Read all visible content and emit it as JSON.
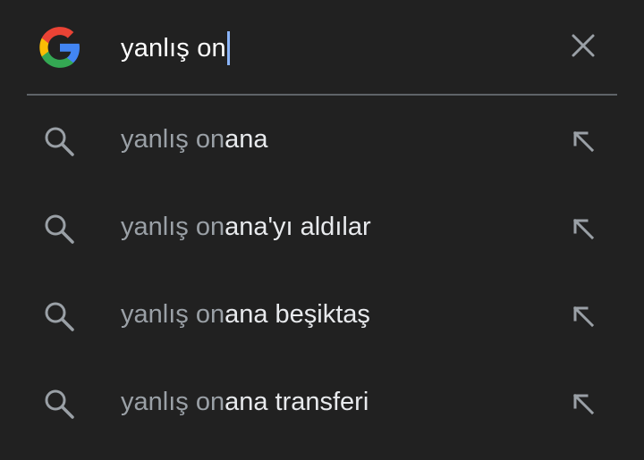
{
  "search": {
    "query": "yanlış on",
    "logo_icon": "google-g-icon",
    "clear_icon": "close-icon"
  },
  "suggestions": [
    {
      "prefix": "yanlış on",
      "completion": "ana",
      "icon": "search-icon",
      "action_icon": "arrow-up-left-icon"
    },
    {
      "prefix": "yanlış on",
      "completion": "ana'yı aldılar",
      "icon": "search-icon",
      "action_icon": "arrow-up-left-icon"
    },
    {
      "prefix": "yanlış on",
      "completion": "ana beşiktaş",
      "icon": "search-icon",
      "action_icon": "arrow-up-left-icon"
    },
    {
      "prefix": "yanlış on",
      "completion": "ana transferi",
      "icon": "search-icon",
      "action_icon": "arrow-up-left-icon"
    }
  ],
  "colors": {
    "background": "#212121",
    "query_text": "#ffffff",
    "prefix_text": "#9aa0a6",
    "completion_text": "#e8eaed",
    "caret": "#8ab4f8",
    "divider": "#5f6368",
    "icon": "#9aa0a6"
  }
}
